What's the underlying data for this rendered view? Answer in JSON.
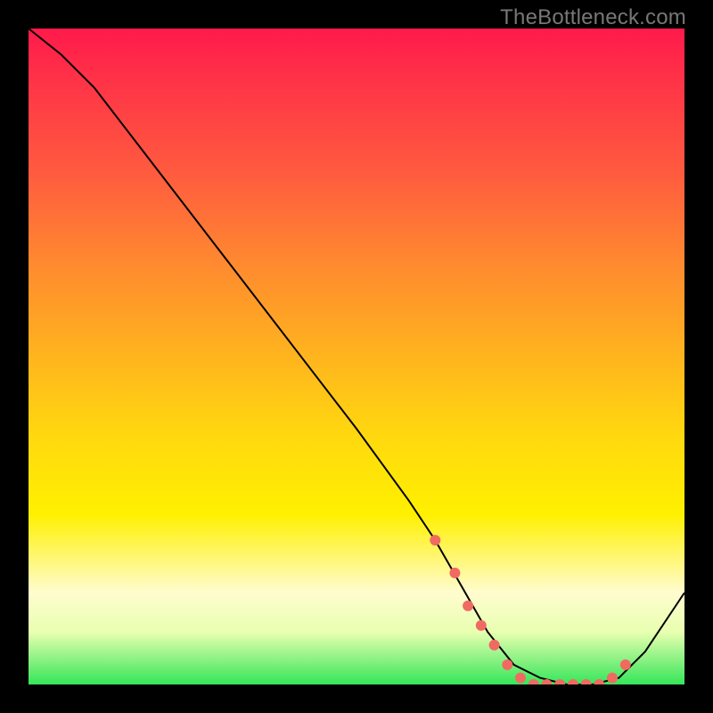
{
  "watermark": {
    "text": "TheBottleneck.com"
  },
  "chart_data": {
    "type": "line",
    "title": "",
    "xlabel": "",
    "ylabel": "",
    "xlim": [
      0,
      100
    ],
    "ylim": [
      0,
      100
    ],
    "series": [
      {
        "name": "curve",
        "x": [
          0,
          5,
          10,
          20,
          30,
          40,
          50,
          58,
          62,
          66,
          70,
          74,
          78,
          82,
          86,
          90,
          94,
          100
        ],
        "y": [
          100,
          96,
          91,
          78,
          65,
          52,
          39,
          28,
          22,
          15,
          8,
          3,
          1,
          0,
          0,
          1,
          5,
          14
        ]
      }
    ],
    "markers": {
      "name": "dots",
      "x": [
        62,
        65,
        67,
        69,
        71,
        73,
        75,
        77,
        79,
        81,
        83,
        85,
        87,
        89,
        91
      ],
      "y": [
        22,
        17,
        12,
        9,
        6,
        3,
        1,
        0,
        0,
        0,
        0,
        0,
        0,
        1,
        3
      ]
    },
    "background_gradient": {
      "stops": [
        {
          "pos": 0.0,
          "color": "#ff1a4b"
        },
        {
          "pos": 0.5,
          "color": "#ffd80f"
        },
        {
          "pos": 0.74,
          "color": "#fff000"
        },
        {
          "pos": 0.92,
          "color": "#e8ffb0"
        },
        {
          "pos": 1.0,
          "color": "#35e65a"
        }
      ]
    }
  }
}
